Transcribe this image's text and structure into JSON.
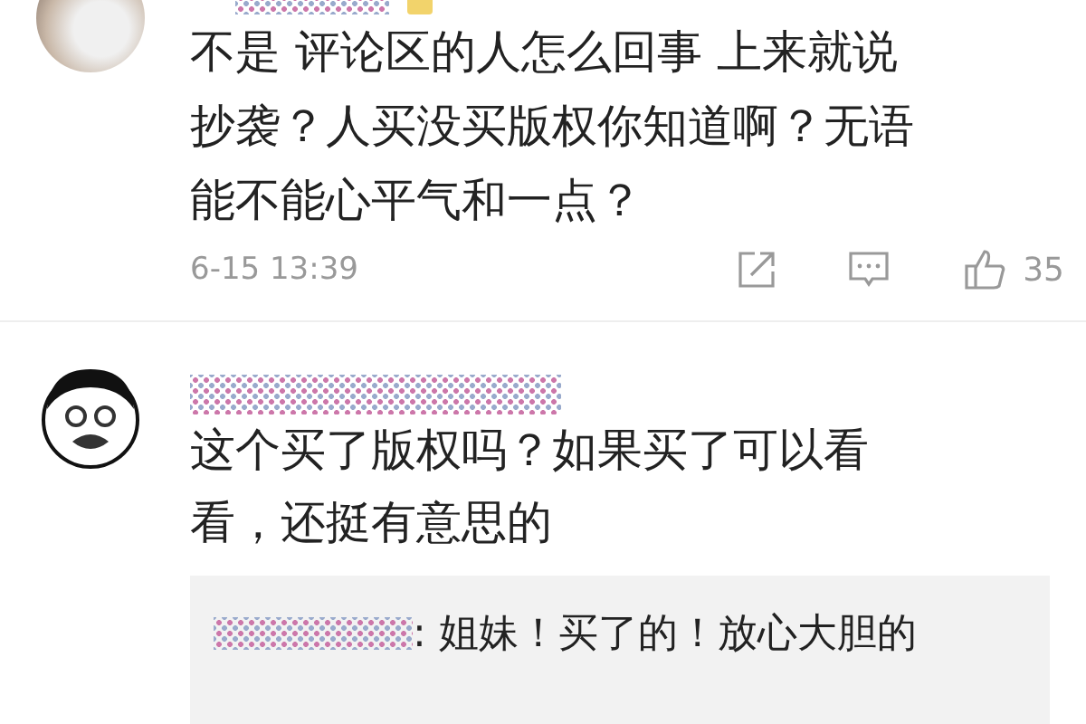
{
  "comments": [
    {
      "avatar": {
        "kind": "photo"
      },
      "name_badge": true,
      "lines": [
        "不是 评论区的人怎么回事  上来就说",
        "抄袭？人买没买版权你知道啊？无语",
        "能不能心平气和一点？"
      ],
      "time": "6-15 13:39",
      "likes": "35"
    },
    {
      "avatar": {
        "kind": "cartoon"
      },
      "name_badge": false,
      "lines": [
        "这个买了版权吗？如果买了可以看",
        "看，还挺有意思的"
      ],
      "replies": [
        {
          "text": ": 姐妹！买了的！放心大胆的"
        }
      ]
    }
  ]
}
